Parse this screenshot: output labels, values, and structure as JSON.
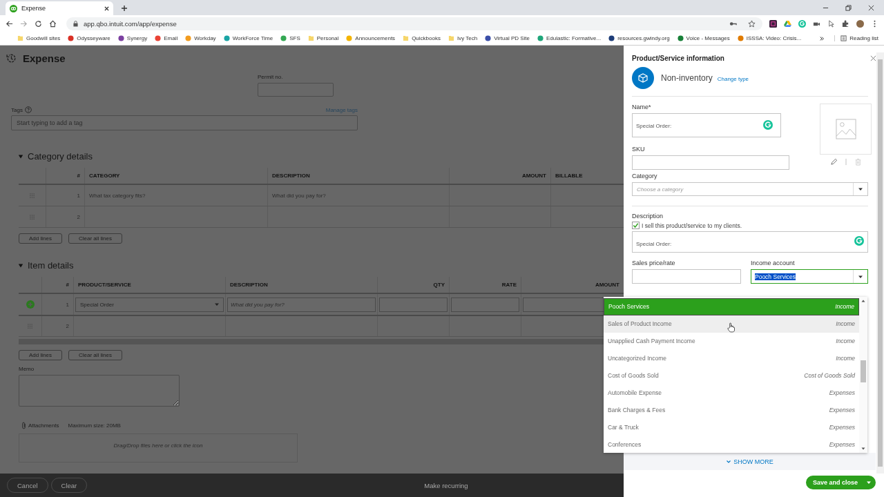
{
  "browser": {
    "tab_title": "Expense",
    "url": "app.qbo.intuit.com/app/expense",
    "bookmarks": [
      {
        "label": "Goodwill sites",
        "kind": "folder"
      },
      {
        "label": "Odysseyware",
        "kind": "site",
        "color": "#d93025"
      },
      {
        "label": "Synergy",
        "kind": "site",
        "color": "#7b3fa0"
      },
      {
        "label": "Email",
        "kind": "site",
        "color": "#ea4335"
      },
      {
        "label": "Workday",
        "kind": "site",
        "color": "#f29c1f"
      },
      {
        "label": "WorkForce Time",
        "kind": "site",
        "color": "#1aa5a5"
      },
      {
        "label": "SFS",
        "kind": "site",
        "color": "#34a853"
      },
      {
        "label": "Personal",
        "kind": "folder"
      },
      {
        "label": "Announcements",
        "kind": "site",
        "color": "#f4b400"
      },
      {
        "label": "Quickbooks",
        "kind": "folder"
      },
      {
        "label": "Ivy Tech",
        "kind": "folder"
      },
      {
        "label": "Virtual PD Site",
        "kind": "site",
        "color": "#3b4ea8"
      },
      {
        "label": "Edulastic: Formative...",
        "kind": "site",
        "color": "#1fa67a"
      },
      {
        "label": "resources.gwindy.org",
        "kind": "site",
        "color": "#1d3c78"
      },
      {
        "label": "Voice - Messages",
        "kind": "site",
        "color": "#188038"
      },
      {
        "label": "ISSSA: Video: Crisis...",
        "kind": "site",
        "color": "#e07b00"
      }
    ],
    "reading_list": "Reading list"
  },
  "page": {
    "title": "Expense",
    "permit_label": "Permit no.",
    "tags_label": "Tags",
    "manage_tags": "Manage tags",
    "tags_placeholder": "Start typing to add a tag",
    "category_section": {
      "title": "Category details",
      "expanded": true,
      "columns": [
        "#",
        "CATEGORY",
        "DESCRIPTION",
        "AMOUNT",
        "BILLABLE"
      ],
      "rows": [
        {
          "num": "1",
          "category_placeholder": "What tax category fits?",
          "description_placeholder": "What did you pay for?"
        },
        {
          "num": "2"
        }
      ],
      "buttons": [
        "Add lines",
        "Clear all lines"
      ]
    },
    "item_section": {
      "title": "Item details",
      "expanded": true,
      "columns": [
        "#",
        "PRODUCT/SERVICE",
        "DESCRIPTION",
        "QTY",
        "RATE",
        "AMOUNT"
      ],
      "rows": [
        {
          "num": "1",
          "product": "Special Order",
          "description_placeholder": "What did you pay for?"
        },
        {
          "num": "2"
        }
      ],
      "buttons": [
        "Add lines",
        "Clear all lines"
      ]
    },
    "memo_label": "Memo",
    "attachments_label": "Attachments",
    "max_size": "Maximum size: 20MB",
    "drop_hint": "Drag/Drop files here or click the icon",
    "footer": {
      "cancel": "Cancel",
      "clear": "Clear",
      "make_recurring": "Make recurring"
    }
  },
  "panel": {
    "title": "Product/Service information",
    "type": "Non-inventory",
    "change_type": "Change type",
    "name_label": "Name*",
    "name_value": "Special Order:",
    "sku_label": "SKU",
    "category_label": "Category",
    "category_placeholder": "Choose a category",
    "description_label": "Description",
    "sell_checkbox": {
      "label": "I sell this product/service to my clients.",
      "checked": true
    },
    "description_value": "Special Order:",
    "sales_price_label": "Sales price/rate",
    "income_account_label": "Income account",
    "income_account_value": "Pooch Services",
    "show_more": "SHOW MORE",
    "save_button": "Save and close"
  },
  "dropdown": {
    "items": [
      {
        "name": "Pooch Services",
        "type": "Income",
        "selected": true,
        "hovered": false
      },
      {
        "name": "Sales of Product Income",
        "type": "Income",
        "selected": false,
        "hovered": true
      },
      {
        "name": "Unapplied Cash Payment Income",
        "type": "Income",
        "selected": false,
        "hovered": false
      },
      {
        "name": "Uncategorized Income",
        "type": "Income",
        "selected": false,
        "hovered": false
      },
      {
        "name": "Cost of Goods Sold",
        "type": "Cost of Goods Sold",
        "selected": false,
        "hovered": false
      },
      {
        "name": "Automobile Expense",
        "type": "Expenses",
        "selected": false,
        "hovered": false
      },
      {
        "name": "Bank Charges & Fees",
        "type": "Expenses",
        "selected": false,
        "hovered": false
      },
      {
        "name": "Car & Truck",
        "type": "Expenses",
        "selected": false,
        "hovered": false
      },
      {
        "name": "Conferences",
        "type": "Expenses",
        "selected": false,
        "hovered": false
      }
    ]
  }
}
